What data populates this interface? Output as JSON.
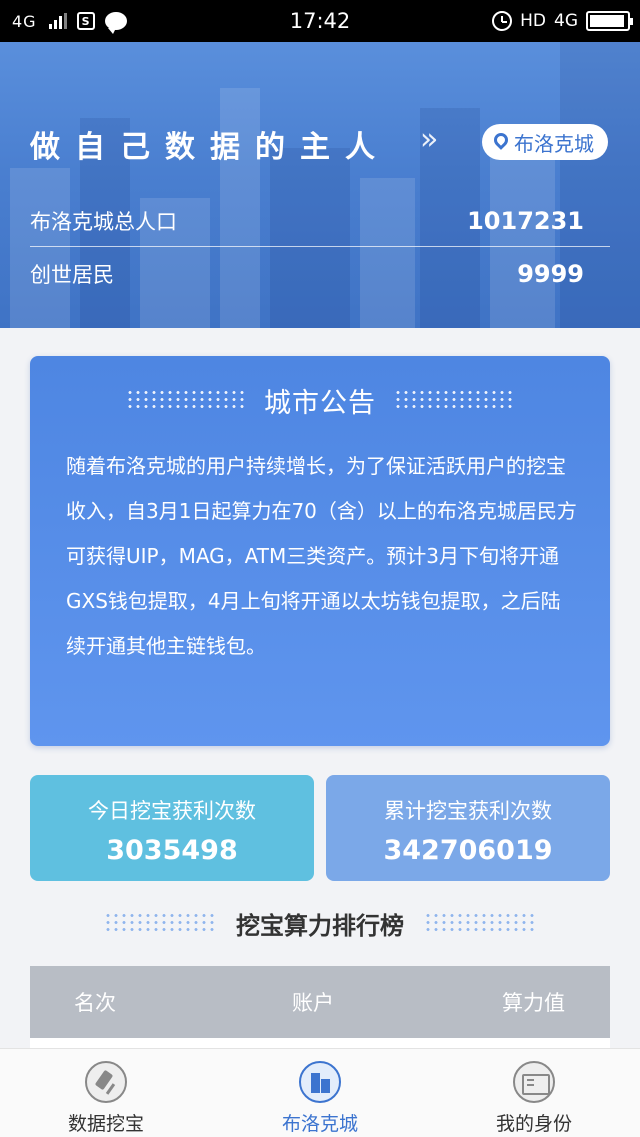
{
  "status_bar": {
    "network": "4G",
    "time": "17:42",
    "hd": "HD",
    "network_right": "4G",
    "battery_level": 0.95
  },
  "hero": {
    "slogan": "做自己数据的主人",
    "arrow": "»",
    "city_name": "布洛克城",
    "population_label": "布洛克城总人口",
    "population_value": "1017231",
    "founders_label": "创世居民",
    "founders_value": "9999"
  },
  "notice": {
    "title": "城市公告",
    "body": "随着布洛克城的用户持续增长，为了保证活跃用户的挖宝收入，自3月1日起算力在70（含）以上的布洛克城居民方可获得UIP，MAG，ATM三类资产。预计3月下旬将开通GXS钱包提取，4月上旬将开通以太坊钱包提取，之后陆续开通其他主链钱包。"
  },
  "stats": [
    {
      "label": "今日挖宝获利次数",
      "value": "3035498"
    },
    {
      "label": "累计挖宝获利次数",
      "value": "342706019"
    }
  ],
  "ranking": {
    "title": "挖宝算力排行榜",
    "columns": [
      "名次",
      "账户",
      "算力值"
    ]
  },
  "tabbar": {
    "items": [
      {
        "label": "数据挖宝",
        "icon": "shovel-icon"
      },
      {
        "label": "布洛克城",
        "icon": "building-icon"
      },
      {
        "label": "我的身份",
        "icon": "id-card-icon"
      }
    ],
    "active_index": 1
  },
  "colors": {
    "hero_blue": "#4a7fd0",
    "notice_blue": "#5a90ea",
    "stat_cyan": "#5fc0e0",
    "stat_blue": "#7ba8e8",
    "accent": "#3c74cf"
  }
}
